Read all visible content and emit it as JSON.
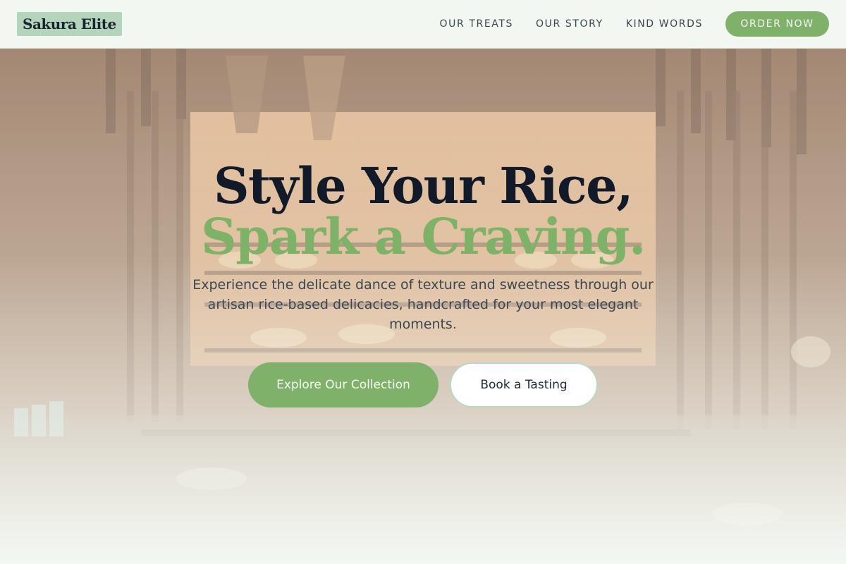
{
  "brand": {
    "name": "Sakura Elite"
  },
  "nav": {
    "items": [
      {
        "label": "OUR TREATS"
      },
      {
        "label": "OUR STORY"
      },
      {
        "label": "KIND WORDS"
      }
    ],
    "order_label": "ORDER NOW"
  },
  "hero": {
    "headline_line1": "Style Your Rice,",
    "headline_line2": "Spark a Craving.",
    "subtitle": "Experience the delicate dance of texture and sweetness through our artisan rice-based delicacies, handcrafted for your most elegant moments.",
    "primary_cta": "Explore Our Collection",
    "secondary_cta": "Book a Tasting"
  },
  "colors": {
    "accent_green": "#80b16a",
    "headline_dark": "#121a2a",
    "logo_bg": "#b4d5bc",
    "page_bg": "#f3f7f2"
  }
}
